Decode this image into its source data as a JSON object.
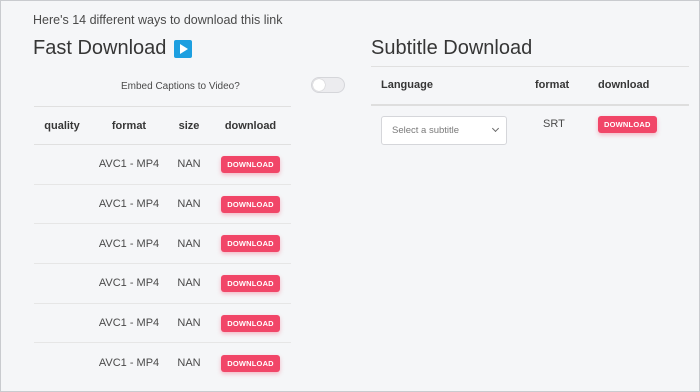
{
  "intro_text": "Here's 14 different ways to download this link",
  "fast_download": {
    "title": "Fast Download",
    "embed_label": "Embed Captions to Video?",
    "columns": [
      "quality",
      "format",
      "size",
      "download"
    ],
    "rows": [
      {
        "quality": "",
        "format": "AVC1 - MP4",
        "size": "NAN",
        "button": "DOWNLOAD"
      },
      {
        "quality": "",
        "format": "AVC1 - MP4",
        "size": "NAN",
        "button": "DOWNLOAD"
      },
      {
        "quality": "",
        "format": "AVC1 - MP4",
        "size": "NAN",
        "button": "DOWNLOAD"
      },
      {
        "quality": "",
        "format": "AVC1 - MP4",
        "size": "NAN",
        "button": "DOWNLOAD"
      },
      {
        "quality": "",
        "format": "AVC1 - MP4",
        "size": "NAN",
        "button": "DOWNLOAD"
      },
      {
        "quality": "",
        "format": "AVC1 - MP4",
        "size": "NAN",
        "button": "DOWNLOAD"
      }
    ]
  },
  "subtitle_download": {
    "title": "Subtitle Download",
    "columns": [
      "Language",
      "format",
      "download"
    ],
    "select_placeholder": "Select a subtitle",
    "format": "SRT",
    "button": "DOWNLOAD"
  },
  "colors": {
    "button": "#f14668",
    "play_icon": "#1d9fe0",
    "background": "#f5f6f8"
  }
}
